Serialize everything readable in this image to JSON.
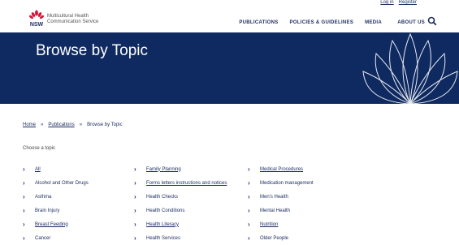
{
  "top_links": [
    "Log in",
    "Register"
  ],
  "org": {
    "line1": "Multicultural Health",
    "line2": "Communication Service",
    "logo_text": "NSW"
  },
  "nav": {
    "publications": "PUBLICATIONS",
    "policies": "POLICIES & GUIDELINES",
    "media": "MEDIA",
    "about": "ABOUT US"
  },
  "hero": {
    "title": "Browse by Topic"
  },
  "breadcrumb": {
    "home": "Home",
    "sep1": "»",
    "publications": "Publications",
    "sep2": "»",
    "current": "Browse by Topic"
  },
  "choose_label": "Choose a topic",
  "topics": {
    "col1": [
      "All",
      "Alcohol and Other Drugs",
      "Asthma",
      "Brain Injury",
      "Breast Feeding",
      "Cancer"
    ],
    "col2": [
      "Family Planning",
      "Forms letters instructions and notices",
      "Health Checks",
      "Health Conditions",
      "Health Literacy",
      "Health Services"
    ],
    "col3": [
      "Medical Procedures",
      "Medication management",
      "Men's Health",
      "Mental Health",
      "Nutrition",
      "Older People"
    ]
  },
  "icons": {
    "chevron": "chevron-right-icon",
    "search": "search-icon",
    "logo": "waratah-logo"
  },
  "colors": {
    "navy": "#0f2a60",
    "red": "#d7153a",
    "text": "#1a2b5f"
  }
}
